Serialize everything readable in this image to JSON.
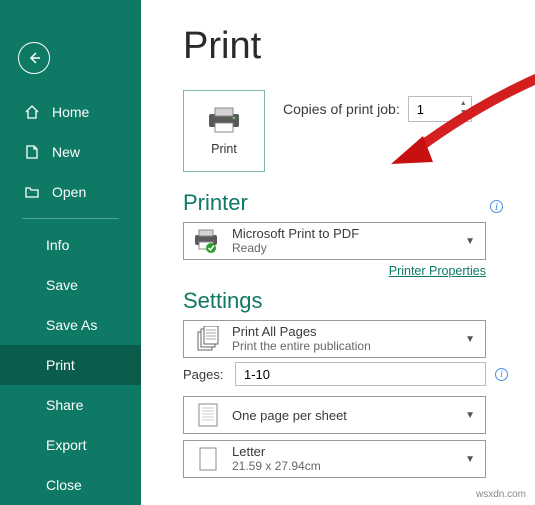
{
  "sidebar": {
    "home": "Home",
    "new": "New",
    "open": "Open",
    "info": "Info",
    "save": "Save",
    "saveAs": "Save As",
    "print": "Print",
    "share": "Share",
    "export": "Export",
    "close": "Close"
  },
  "main": {
    "title": "Print",
    "printBtn": "Print",
    "copiesLabel": "Copies of print job:",
    "copiesValue": "1",
    "printerHeading": "Printer",
    "printerName": "Microsoft Print to PDF",
    "printerStatus": "Ready",
    "printerPropsLink": "Printer Properties",
    "settingsHeading": "Settings",
    "printAll": "Print All Pages",
    "printAllSub": "Print the entire publication",
    "pagesLabel": "Pages:",
    "pagesValue": "1-10",
    "onePerSheet": "One page per sheet",
    "paperName": "Letter",
    "paperSize": "21.59 x 27.94cm"
  },
  "watermark": "wsxdn.com"
}
